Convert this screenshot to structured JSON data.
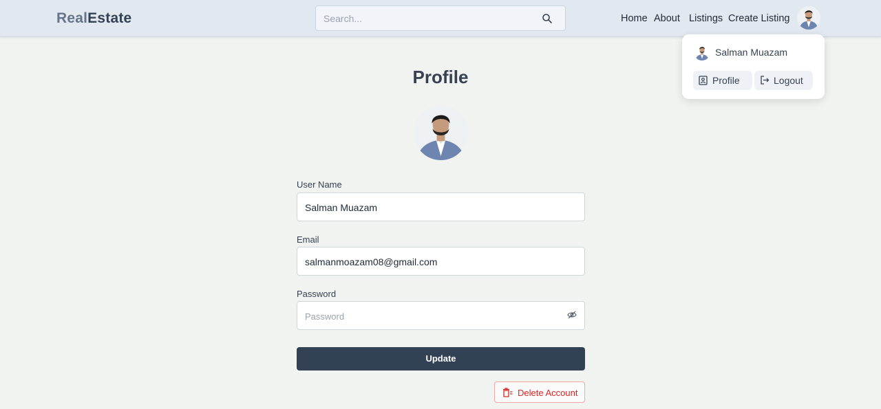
{
  "header": {
    "logo_part1": "Real",
    "logo_part2": "Estate",
    "search_placeholder": "Search...",
    "nav": [
      "Home",
      "About",
      "Listings",
      "Create Listing"
    ]
  },
  "dropdown": {
    "user_name": "Salman Muazam",
    "profile_label": "Profile",
    "logout_label": "Logout"
  },
  "main": {
    "title": "Profile",
    "username_label": "User Name",
    "username_value": "Salman Muazam",
    "email_label": "Email",
    "email_value": "salmanmoazam08@gmail.com",
    "password_label": "Password",
    "password_placeholder": "Password",
    "update_label": "Update",
    "delete_label": "Delete Account"
  },
  "colors": {
    "primary": "#334155",
    "danger": "#dc2626",
    "background": "#f0f3f0",
    "header": "#e2e8f0"
  }
}
